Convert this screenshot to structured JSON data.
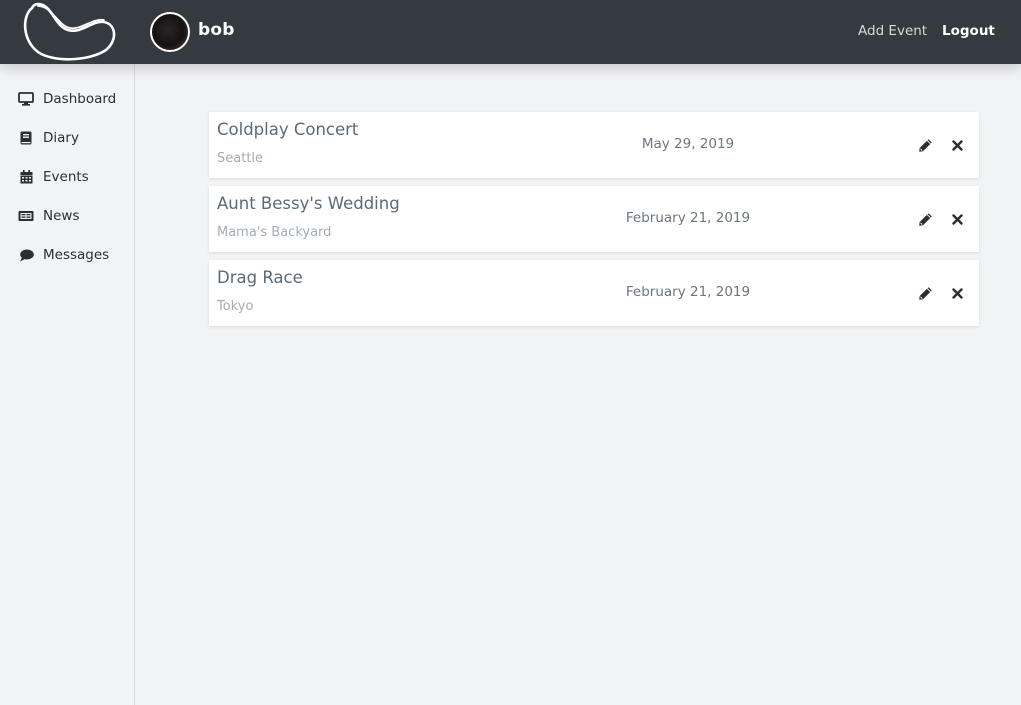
{
  "header": {
    "logo_icon": "bean-logo-icon",
    "username": "bob",
    "avatar_icon": "user-avatar",
    "nav": [
      {
        "label": "Add Event"
      },
      {
        "label": "Logout"
      }
    ]
  },
  "sidebar": {
    "items": [
      {
        "label": "Dashboard",
        "icon": "desktop-icon"
      },
      {
        "label": "Diary",
        "icon": "book-icon"
      },
      {
        "label": "Events",
        "icon": "calendar-icon"
      },
      {
        "label": "News",
        "icon": "newspaper-icon"
      },
      {
        "label": "Messages",
        "icon": "comment-icon"
      }
    ]
  },
  "events": [
    {
      "title": "Coldplay Concert",
      "location": "Seattle",
      "date": "May 29, 2019",
      "edit_icon": "pencil-icon",
      "delete_icon": "close-icon"
    },
    {
      "title": "Aunt Bessy's Wedding",
      "location": "Mama's Backyard",
      "date": "February 21, 2019",
      "edit_icon": "pencil-icon",
      "delete_icon": "close-icon"
    },
    {
      "title": "Drag Race",
      "location": "Tokyo",
      "date": "February 21, 2019",
      "edit_icon": "pencil-icon",
      "delete_icon": "close-icon"
    }
  ]
}
